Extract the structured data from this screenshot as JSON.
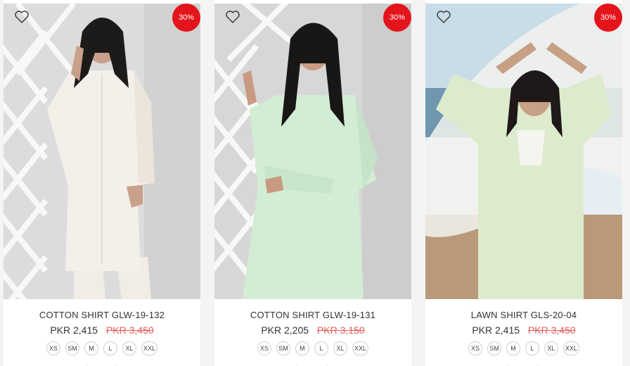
{
  "products": [
    {
      "title": "COTTON SHIRT GLW-19-132",
      "price": "PKR 2,415",
      "old_price": "PKR 3,450",
      "discount": "30%",
      "sizes": [
        "XS",
        "SM",
        "M",
        "L",
        "XL",
        "XXL"
      ]
    },
    {
      "title": "COTTON SHIRT GLW-19-131",
      "price": "PKR 2,205",
      "old_price": "PKR 3,150",
      "discount": "30%",
      "sizes": [
        "XS",
        "SM",
        "M",
        "L",
        "XL",
        "XXL"
      ]
    },
    {
      "title": "LAWN SHIRT GLS-20-04",
      "price": "PKR 2,415",
      "old_price": "PKR 3,450",
      "discount": "30%",
      "sizes": [
        "XS",
        "SM",
        "M",
        "L",
        "XL",
        "XXL"
      ]
    }
  ],
  "colors": {
    "badge": "#e3141b",
    "old_price": "#e35b5b",
    "shirt_white": "#f3efe9",
    "shirt_mint": "#d3ecd4",
    "shirt_lawn": "#dcebcd"
  },
  "icons": {
    "wishlist": "heart-icon"
  }
}
